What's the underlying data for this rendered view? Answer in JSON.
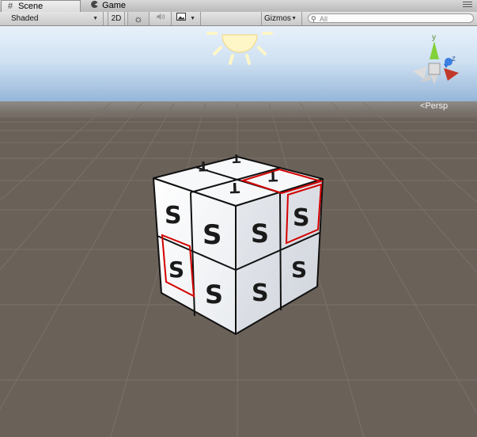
{
  "tabs": [
    {
      "label": "Scene",
      "icon": "grid-icon",
      "active": true
    },
    {
      "label": "Game",
      "icon": "pacman-icon",
      "active": false
    }
  ],
  "toolbar": {
    "draw_mode": "Shaded",
    "mode_2d": "2D",
    "lighting_icon": "sun-icon",
    "audio_icon": "speaker-icon",
    "effects_icon": "image-icon",
    "gizmos": "Gizmos",
    "search_placeholder": "All"
  },
  "scene": {
    "projection_label": "Persp",
    "axis_labels": {
      "y": "y",
      "z": "z"
    },
    "colors": {
      "sky_top": "#e4eef9",
      "sky_bottom": "#9fc0e0",
      "ground": "#6a6159",
      "grid_line": "#7a726b",
      "selection": "#d40000",
      "axis_x": "#c0392b",
      "axis_y": "#7fcf2f",
      "axis_z": "#2e6fd8"
    },
    "cube_faces": {
      "top": [
        "T",
        "T",
        "T",
        "T"
      ],
      "front": [
        "S",
        "S",
        "S",
        "S"
      ],
      "right": [
        "S",
        "S",
        "S",
        "S"
      ]
    }
  }
}
